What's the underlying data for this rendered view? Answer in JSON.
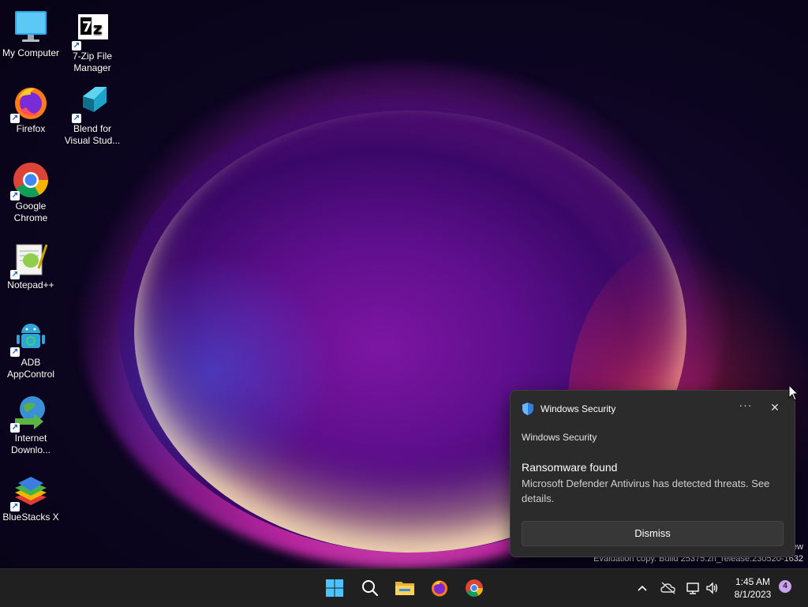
{
  "desktop": {
    "icons": [
      {
        "label": "My Computer"
      },
      {
        "label": "7-Zip File Manager"
      },
      {
        "label": "Firefox"
      },
      {
        "label": "Blend for Visual Stud..."
      },
      {
        "label": "Google Chrome"
      },
      {
        "label": "Notepad++"
      },
      {
        "label": "ADB AppControl"
      },
      {
        "label": "Internet Downlo..."
      },
      {
        "label": "BlueStacks X"
      }
    ]
  },
  "notification": {
    "header_app": "Windows Security",
    "more_label": "···",
    "close_label": "✕",
    "app_name": "Windows Security",
    "title": "Ransomware found",
    "body": "Microsoft Defender Antivirus has detected threats. See details.",
    "dismiss_label": "Dismiss"
  },
  "watermark": {
    "line1": "ew",
    "line2": "Evaluation copy. Build 25375.zn_release.230520-1632"
  },
  "taskbar": {
    "time": "1:45 AM",
    "date": "8/1/2023",
    "notification_count": "4",
    "accent": "#4cc2ff"
  }
}
